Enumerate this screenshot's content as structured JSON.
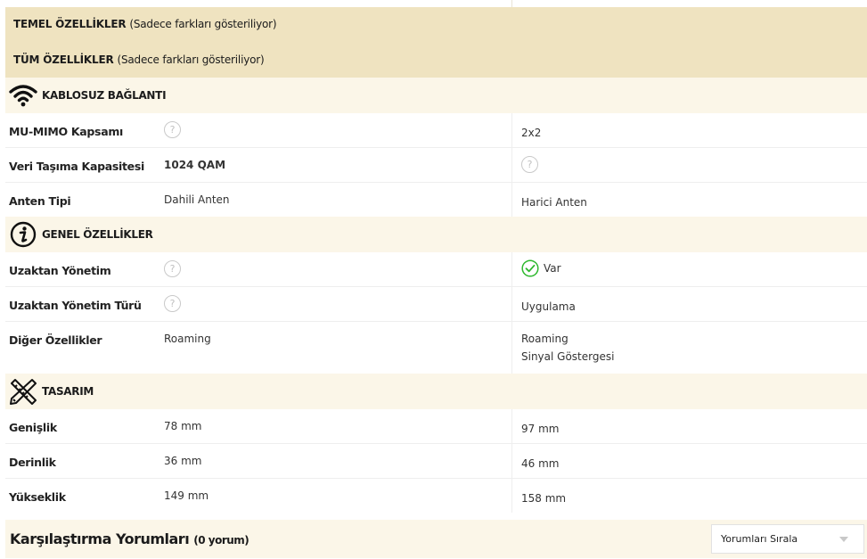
{
  "toggles": {
    "basic_label": "TEMEL ÖZELLİKLER",
    "basic_note": "(Sadece farkları gösteriliyor)",
    "all_label": "TÜM ÖZELLİKLER",
    "all_note": "(Sadece farkları gösteriliyor)"
  },
  "sections": {
    "wireless": {
      "title": "KABLOSUZ BAĞLANTI",
      "icon": "wifi-icon",
      "rows": [
        {
          "label": "MU-MIMO Kapsamı",
          "c1": "",
          "c1_icon": "question-icon",
          "c2": "2x2"
        },
        {
          "label": "Veri Taşıma Kapasitesi",
          "c1": "1024 QAM",
          "c2": "",
          "c2_icon": "question-icon"
        },
        {
          "label": "Anten Tipi",
          "c1": "Dahili Anten",
          "c2": "Harici Anten"
        }
      ]
    },
    "general": {
      "title": "GENEL ÖZELLİKLER",
      "icon": "info-icon",
      "rows": [
        {
          "label": "Uzaktan Yönetim",
          "c1_icon": "question-icon",
          "c2": "Var",
          "c2_icon": "check-icon"
        },
        {
          "label": "Uzaktan Yönetim Türü",
          "c1_icon": "question-icon",
          "c2": "Uygulama"
        },
        {
          "label": "Diğer Özellikler",
          "c1": "Roaming",
          "c2_line1": "Roaming",
          "c2_line2": "Sinyal Göstergesi"
        }
      ]
    },
    "design": {
      "title": "TASARIM",
      "icon": "ruler-pencil-icon",
      "rows": [
        {
          "label": "Genişlik",
          "c1": "78 mm",
          "c2": "97 mm"
        },
        {
          "label": "Derinlik",
          "c1": "36 mm",
          "c2": "46 mm"
        },
        {
          "label": "Yükseklik",
          "c1": "149 mm",
          "c2": "158 mm"
        }
      ]
    }
  },
  "question_glyph": "?",
  "footer": {
    "title": "Karşılaştırma Yorumları",
    "count": "(0 yorum)",
    "sort_label": "Yorumları Sırala"
  },
  "colors": {
    "toggle_bg": "#efe3c0",
    "section_bg": "#fbf6e8",
    "check_green": "#2eb82e"
  }
}
